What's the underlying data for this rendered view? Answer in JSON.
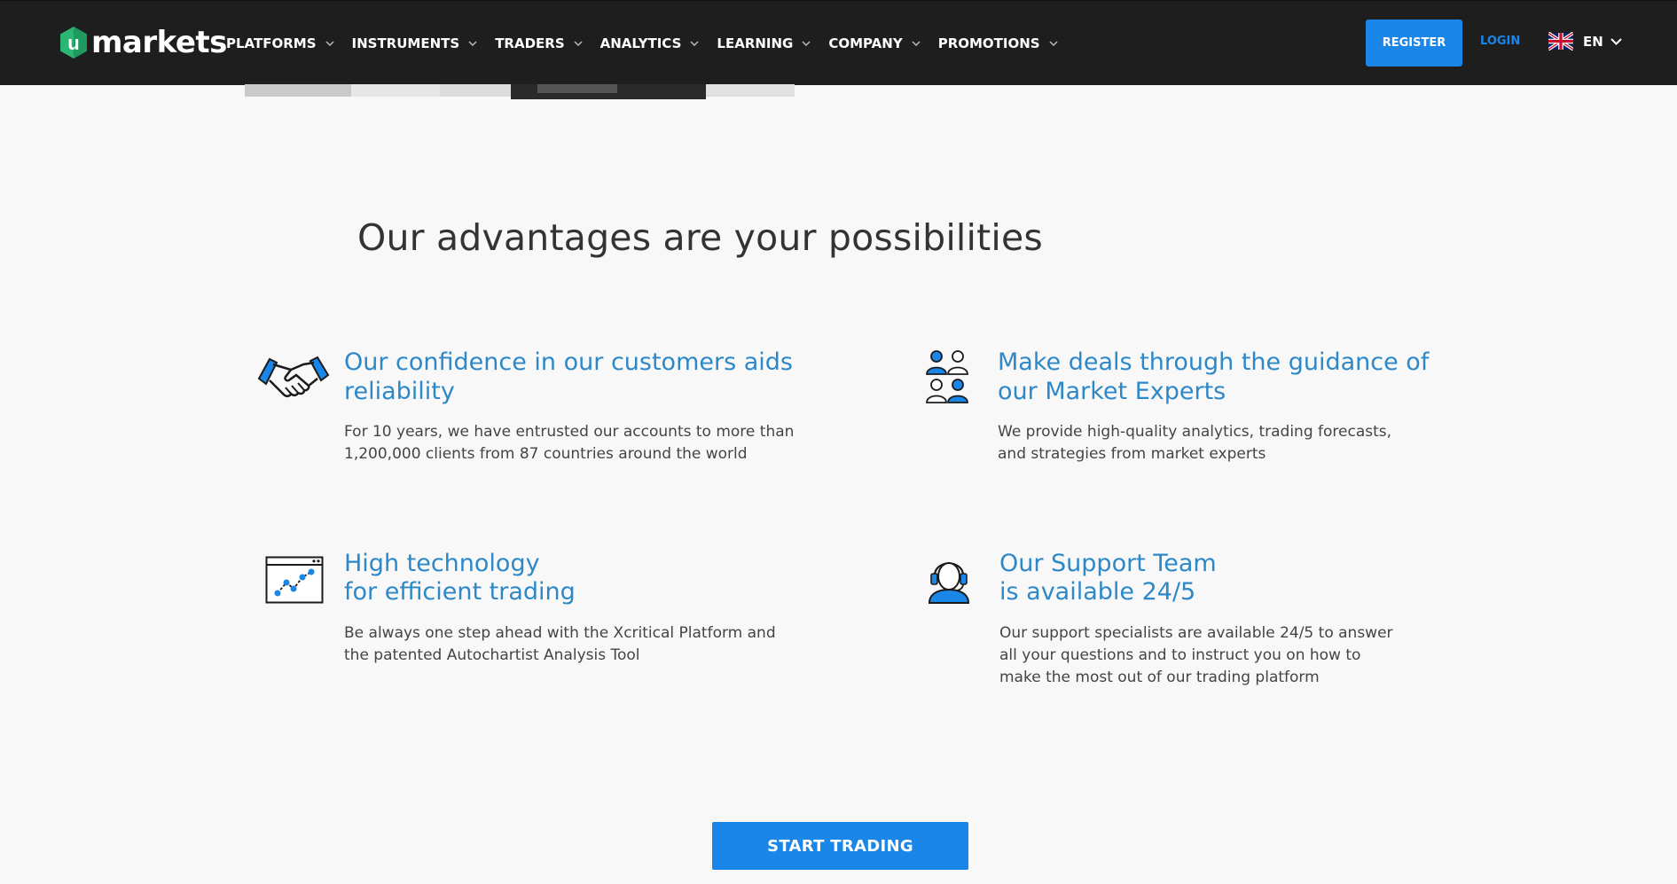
{
  "header": {
    "logo": {
      "mark": "u",
      "word": "markets"
    },
    "nav": [
      {
        "label": "PLATFORMS"
      },
      {
        "label": "INSTRUMENTS"
      },
      {
        "label": "TRADERS"
      },
      {
        "label": "ANALYTICS"
      },
      {
        "label": "LEARNING"
      },
      {
        "label": "COMPANY"
      },
      {
        "label": "PROMOTIONS"
      }
    ],
    "register_label": "REGISTER",
    "login_label": "LOGIN",
    "language": {
      "code": "EN",
      "flag_icon": "uk-flag-icon"
    }
  },
  "section": {
    "heading": "Our advantages are your possibilities",
    "cards": [
      {
        "icon": "handshake-icon",
        "title_lines": [
          "Our confidence in our customers aids",
          "reliability"
        ],
        "text_lines": [
          "For 10 years, we have entrusted our accounts to more than",
          "1,200,000 clients from 87 countries around the world"
        ]
      },
      {
        "icon": "experts-group-icon",
        "title_lines": [
          "Make deals through the guidance of",
          "our Market Experts"
        ],
        "text_lines": [
          "We provide high-quality analytics, trading forecasts,",
          "and strategies from market experts"
        ]
      },
      {
        "icon": "chart-window-icon",
        "title_lines": [
          "High technology",
          "for efficient trading"
        ],
        "text_lines": [
          "Be always one step ahead with the Xcritical Platform and",
          "the patented Autochartist Analysis Tool"
        ]
      },
      {
        "icon": "support-headset-icon",
        "title_lines": [
          "Our Support Team",
          "is available 24/5"
        ],
        "text_lines": [
          "Our support specialists are available 24/5 to answer",
          "all your questions and to instruct you on how to",
          "make the most out of our trading platform"
        ]
      }
    ]
  },
  "cta_label": "START TRADING",
  "colors": {
    "topbar": "#1e1e1e",
    "accent": "#1a86e8",
    "title_blue": "#2d88c8",
    "logo_green": "#2bb673",
    "page_bg": "#f8f8f8"
  }
}
